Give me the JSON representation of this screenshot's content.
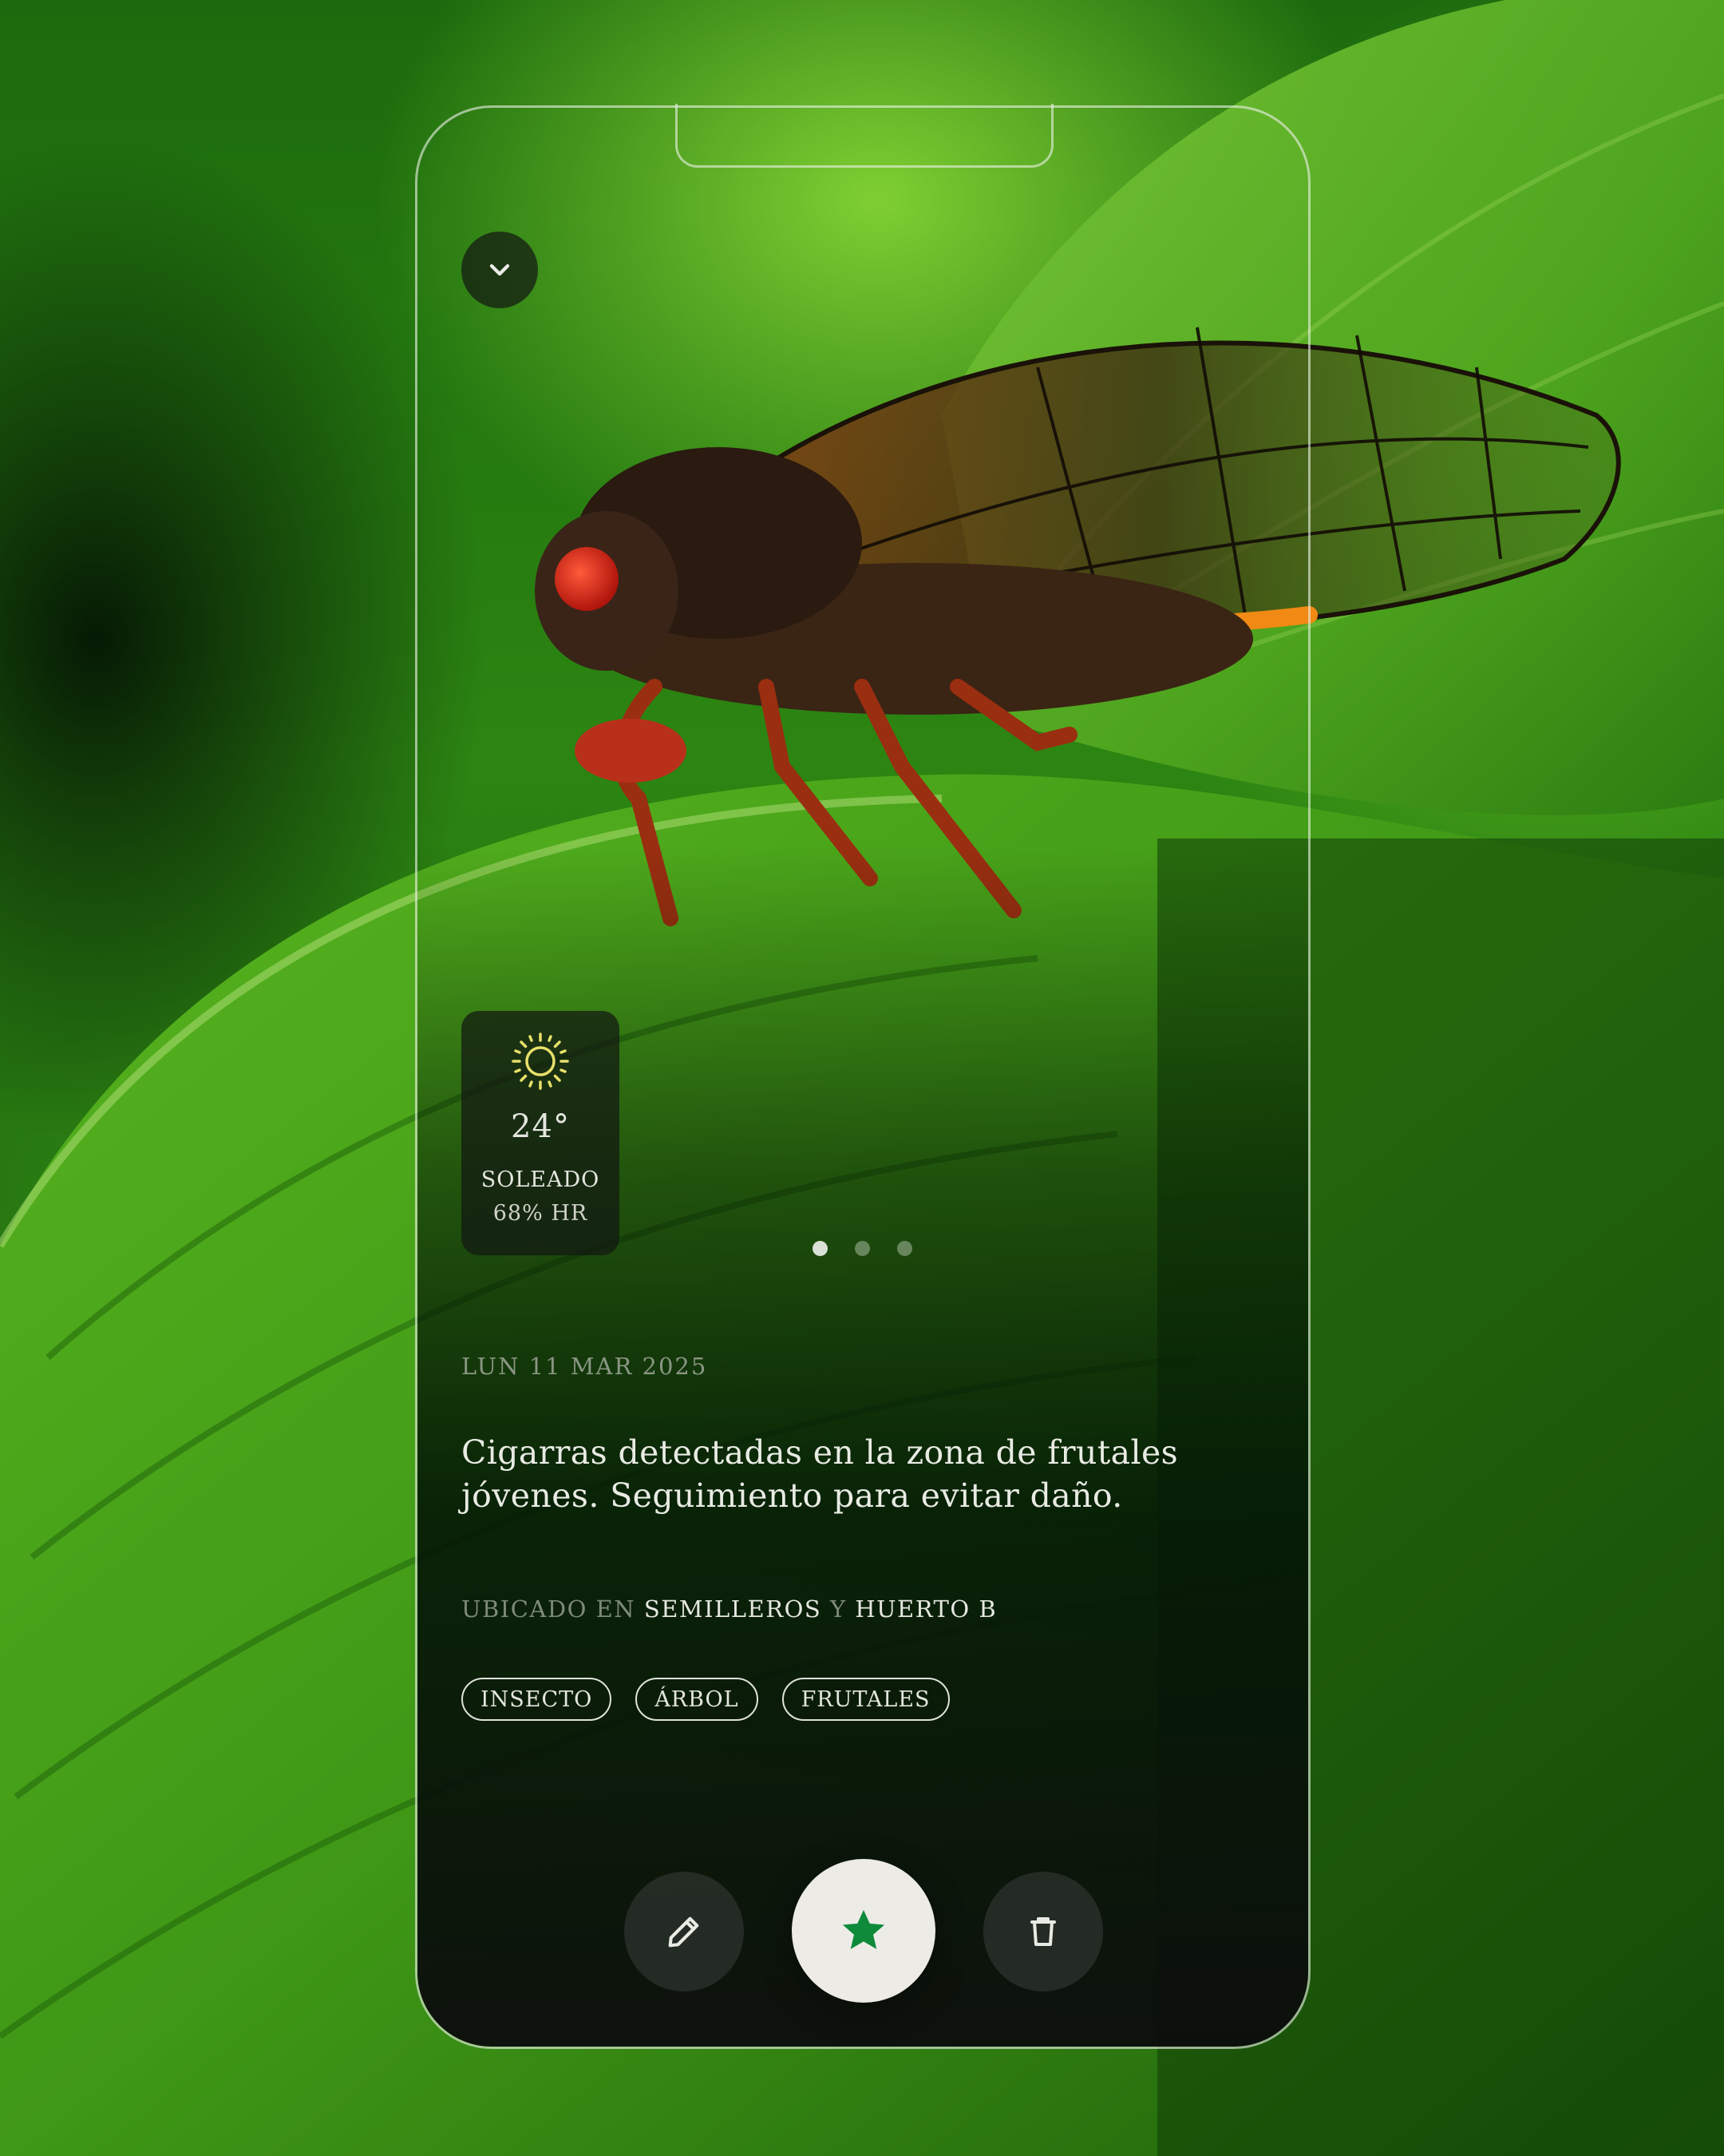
{
  "colors": {
    "accent_star": "#0e8a3a",
    "sun": "#e8e06a",
    "fav_button_bg": "#ecebe6"
  },
  "header": {
    "collapse_icon": "chevron-down-icon"
  },
  "weather": {
    "icon": "sun-icon",
    "temperature": "24°",
    "condition": "SOLEADO",
    "humidity": "68% HR"
  },
  "carousel": {
    "page_count": 3,
    "active_index": 0
  },
  "entry": {
    "date": "LUN 11 MAR 2025",
    "description": "Cigarras detectadas en la zona de frutales jóvenes. Seguimiento para evitar daño.",
    "location_prefix": "UBICADO EN",
    "location_1": "SEMILLEROS",
    "location_joiner": "Y",
    "location_2": "HUERTO B",
    "tags": [
      "INSECTO",
      "ÁRBOL",
      "FRUTALES"
    ]
  },
  "actions": {
    "edit_icon": "pencil-icon",
    "favorite_icon": "star-icon",
    "delete_icon": "trash-icon"
  }
}
